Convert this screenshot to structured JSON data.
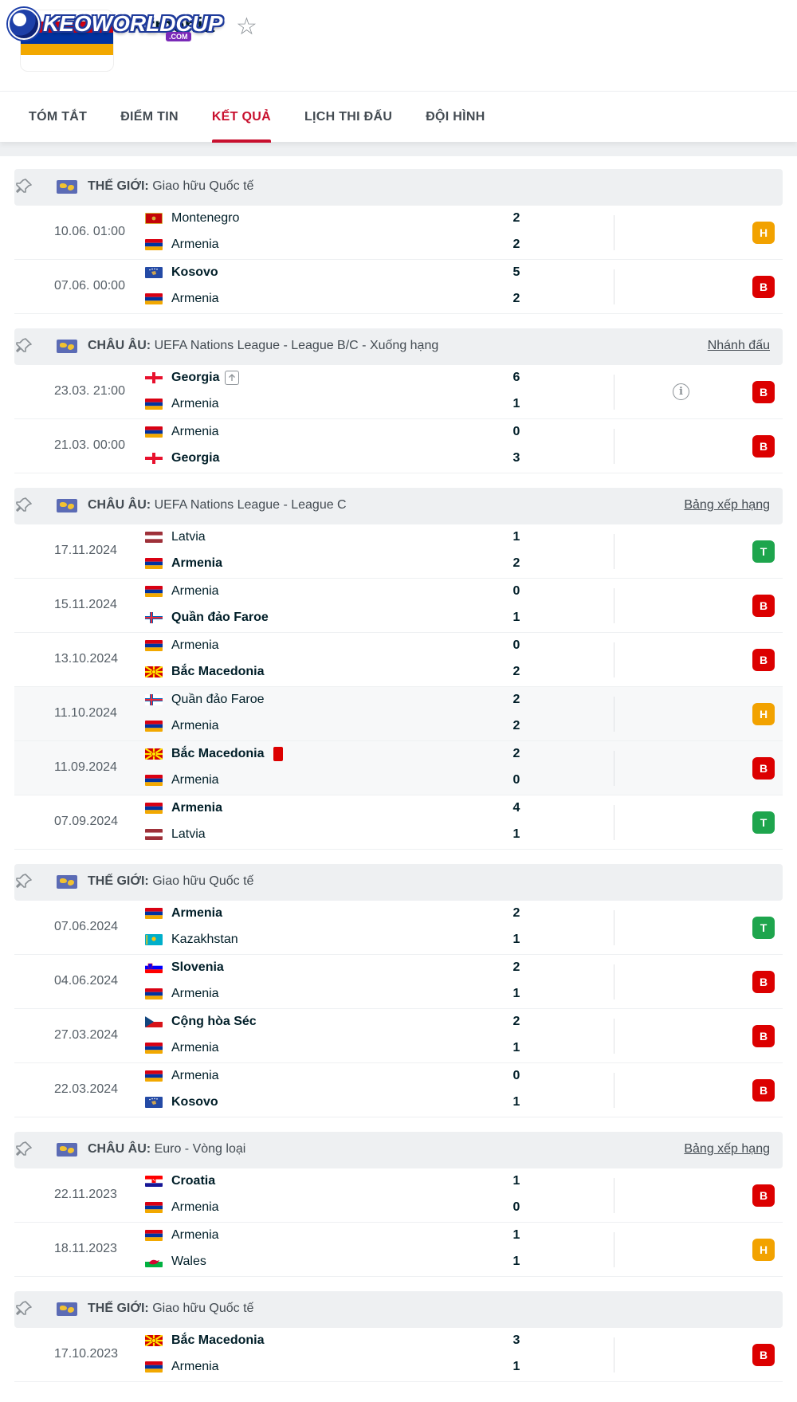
{
  "brand": {
    "text": "KEOWORLDCUP",
    "suffix": ".COM"
  },
  "team": {
    "name": "Armenia",
    "flag_colors": [
      "#d90012",
      "#0033a0",
      "#f2a800"
    ]
  },
  "tabs": [
    {
      "label": "TÓM TẮT",
      "active": false
    },
    {
      "label": "ĐIỂM TIN",
      "active": false
    },
    {
      "label": "KẾT QUẢ",
      "active": true
    },
    {
      "label": "LỊCH THI ĐẤU",
      "active": false
    },
    {
      "label": "ĐỘI HÌNH",
      "active": false
    }
  ],
  "colors": {
    "accent": "#c8102e",
    "win": "#1ea54d",
    "draw": "#f2a200",
    "loss": "#dc0000"
  },
  "sections": [
    {
      "region": "THẾ GIỚI:",
      "name": "Giao hữu Quốc tế",
      "link": "",
      "matches": [
        {
          "date": "10.06. 01:00",
          "home": "Montenegro",
          "away": "Armenia",
          "hs": "2",
          "as": "2",
          "win": "",
          "form": "H",
          "info": false
        },
        {
          "date": "07.06. 00:00",
          "home": "Kosovo",
          "away": "Armenia",
          "hs": "5",
          "as": "2",
          "win": "home",
          "form": "B",
          "info": false
        }
      ]
    },
    {
      "region": "CHÂU ÂU:",
      "name": "UEFA Nations League - League B/C - Xuống hạng",
      "link": "Nhánh đấu",
      "matches": [
        {
          "date": "23.03. 21:00",
          "home": "Georgia",
          "away": "Armenia",
          "hs": "6",
          "as": "1",
          "win": "home",
          "form": "B",
          "info": true,
          "home_up": true
        },
        {
          "date": "21.03. 00:00",
          "home": "Armenia",
          "away": "Georgia",
          "hs": "0",
          "as": "3",
          "win": "away",
          "form": "B",
          "info": false
        }
      ]
    },
    {
      "region": "CHÂU ÂU:",
      "name": "UEFA Nations League - League C",
      "link": "Bảng xếp hạng",
      "matches": [
        {
          "date": "17.11.2024",
          "home": "Latvia",
          "away": "Armenia",
          "hs": "1",
          "as": "2",
          "win": "away",
          "form": "T",
          "info": false
        },
        {
          "date": "15.11.2024",
          "home": "Armenia",
          "away": "Quần đảo Faroe",
          "hs": "0",
          "as": "1",
          "win": "away",
          "form": "B",
          "info": false
        },
        {
          "date": "13.10.2024",
          "home": "Armenia",
          "away": "Bắc Macedonia",
          "hs": "0",
          "as": "2",
          "win": "away",
          "form": "B",
          "info": false
        },
        {
          "date": "11.10.2024",
          "home": "Quần đảo Faroe",
          "away": "Armenia",
          "hs": "2",
          "as": "2",
          "win": "",
          "form": "H",
          "info": false,
          "alt": true
        },
        {
          "date": "11.09.2024",
          "home": "Bắc Macedonia",
          "away": "Armenia",
          "hs": "2",
          "as": "0",
          "win": "home",
          "form": "B",
          "info": false,
          "alt": true,
          "home_red": true
        },
        {
          "date": "07.09.2024",
          "home": "Armenia",
          "away": "Latvia",
          "hs": "4",
          "as": "1",
          "win": "home",
          "form": "T",
          "info": false
        }
      ]
    },
    {
      "region": "THẾ GIỚI:",
      "name": "Giao hữu Quốc tế",
      "link": "",
      "matches": [
        {
          "date": "07.06.2024",
          "home": "Armenia",
          "away": "Kazakhstan",
          "hs": "2",
          "as": "1",
          "win": "home",
          "form": "T",
          "info": false
        },
        {
          "date": "04.06.2024",
          "home": "Slovenia",
          "away": "Armenia",
          "hs": "2",
          "as": "1",
          "win": "home",
          "form": "B",
          "info": false
        },
        {
          "date": "27.03.2024",
          "home": "Cộng hòa Séc",
          "away": "Armenia",
          "hs": "2",
          "as": "1",
          "win": "home",
          "form": "B",
          "info": false
        },
        {
          "date": "22.03.2024",
          "home": "Armenia",
          "away": "Kosovo",
          "hs": "0",
          "as": "1",
          "win": "away",
          "form": "B",
          "info": false
        }
      ]
    },
    {
      "region": "CHÂU ÂU:",
      "name": "Euro - Vòng loại",
      "link": "Bảng xếp hạng",
      "matches": [
        {
          "date": "22.11.2023",
          "home": "Croatia",
          "away": "Armenia",
          "hs": "1",
          "as": "0",
          "win": "home",
          "form": "B",
          "info": false
        },
        {
          "date": "18.11.2023",
          "home": "Armenia",
          "away": "Wales",
          "hs": "1",
          "as": "1",
          "win": "",
          "form": "H",
          "info": false
        }
      ]
    },
    {
      "region": "THẾ GIỚI:",
      "name": "Giao hữu Quốc tế",
      "link": "",
      "matches": [
        {
          "date": "17.10.2023",
          "home": "Bắc Macedonia",
          "away": "Armenia",
          "hs": "3",
          "as": "1",
          "win": "home",
          "form": "B",
          "info": false
        }
      ]
    }
  ],
  "flags": {
    "Armenia": [
      "#d90012",
      "#0033a0",
      "#f2a800"
    ],
    "Montenegro": [
      "#c40308",
      "#c40308",
      "#c40308"
    ],
    "Kosovo": [
      "#244aa5",
      "#244aa5",
      "#244aa5"
    ],
    "Georgia": [
      "#ffffff",
      "#ffffff",
      "#ffffff"
    ],
    "Latvia": [
      "#9e3039",
      "#ffffff",
      "#9e3039"
    ],
    "Quần đảo Faroe": [
      "#ffffff",
      "#ffffff",
      "#ffffff"
    ],
    "Bắc Macedonia": [
      "#d20000",
      "#d20000",
      "#d20000"
    ],
    "Kazakhstan": [
      "#00afca",
      "#00afca",
      "#00afca"
    ],
    "Slovenia": [
      "#ffffff",
      "#0000ff",
      "#ff0000"
    ],
    "Cộng hòa Séc": [
      "#ffffff",
      "#d7141a",
      "#d7141a"
    ],
    "Croatia": [
      "#ff0000",
      "#ffffff",
      "#171796"
    ],
    "Wales": [
      "#ffffff",
      "#00b140",
      "#00b140"
    ]
  },
  "info_glyph": "i",
  "up_glyph": "↑"
}
